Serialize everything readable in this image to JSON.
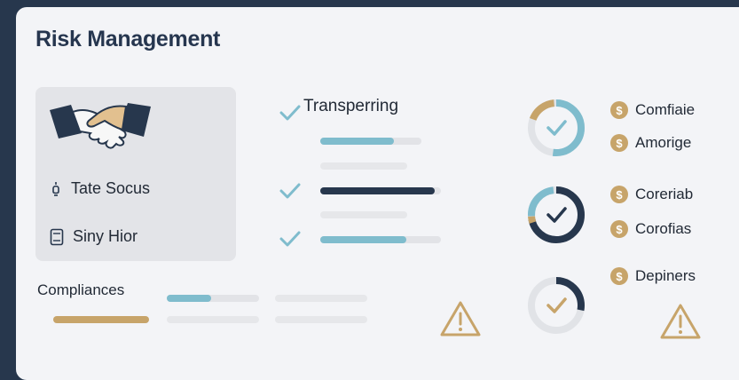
{
  "header": {
    "title": "Risk Management"
  },
  "left_panel": {
    "items": [
      {
        "label": "Tate Socus",
        "icon": "lightbulb-icon"
      },
      {
        "label": "Siny Hior",
        "icon": "document-icon"
      }
    ]
  },
  "checklist": {
    "first_label": "Transperring",
    "progress": [
      0.73,
      0.95,
      0.71
    ]
  },
  "compliance": {
    "label": "Compliances",
    "progress": 0.48
  },
  "donuts": [
    {
      "progress": 0.52,
      "color": "#7fbccd"
    },
    {
      "progress": 0.72,
      "color": "#27374d"
    },
    {
      "progress": 0.28,
      "color": "#27374d"
    }
  ],
  "coin_items": [
    {
      "label": "Comfiaie"
    },
    {
      "label": "Amorige"
    },
    {
      "label": "Coreriab"
    },
    {
      "label": "Corofias"
    },
    {
      "label": "Depiners"
    }
  ],
  "colors": {
    "accent_teal": "#7fbccd",
    "accent_navy": "#27374d",
    "accent_gold": "#c7a46a"
  }
}
